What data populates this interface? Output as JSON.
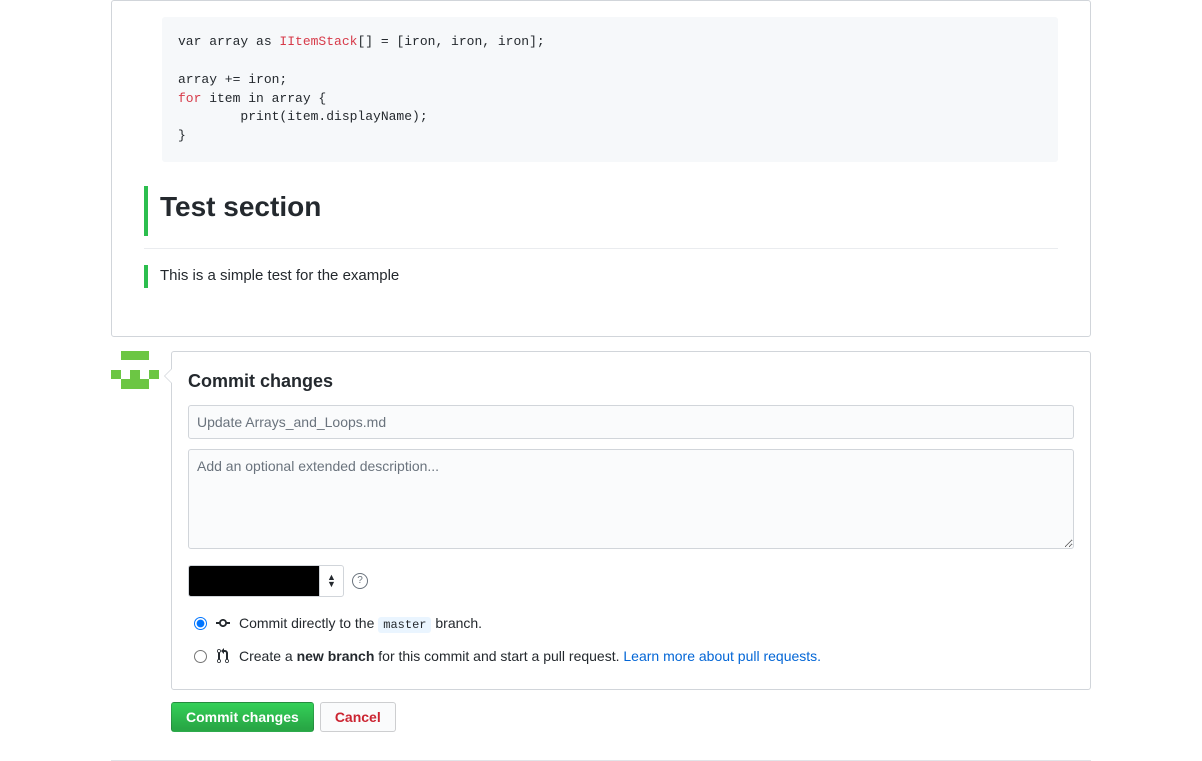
{
  "preview": {
    "code": {
      "line1_pre": "var array as ",
      "line1_type": "IItemStack",
      "line1_post": "[] = [iron, iron, iron];",
      "blank": "",
      "line3": "array += iron;",
      "line4_kw": "for",
      "line4_rest": " item in array {",
      "line5": "        print(item.displayName);",
      "line6": "}"
    },
    "heading": "Test section",
    "quote": "This is a simple test for the example"
  },
  "commit": {
    "title": "Commit changes",
    "summary_placeholder": "Update Arrays_and_Loops.md",
    "description_placeholder": "Add an optional extended description...",
    "direct_pre": "Commit directly to the ",
    "direct_branch": "master",
    "direct_post": " branch.",
    "newbranch_pre": "Create a ",
    "newbranch_strong": "new branch",
    "newbranch_mid": " for this commit and start a pull request. ",
    "newbranch_link": "Learn more about pull requests.",
    "commit_btn": "Commit changes",
    "cancel_btn": "Cancel"
  }
}
